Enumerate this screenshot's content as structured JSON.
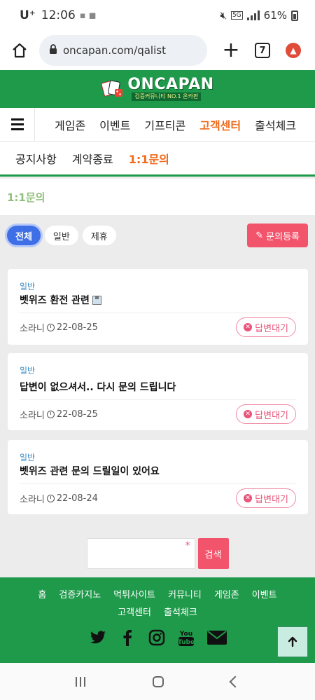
{
  "status_bar": {
    "carrier": "U⁺",
    "time": "12:06",
    "network": "5G",
    "battery": "61%"
  },
  "browser": {
    "url": "oncapan.com/qalist",
    "tab_count": "7"
  },
  "site": {
    "brand": "ONCAPAN",
    "tagline": "검증커뮤니티 NO.1 온카판"
  },
  "main_nav": {
    "items": [
      "게임존",
      "이벤트",
      "기프티콘",
      "고객센터",
      "출석체크"
    ]
  },
  "sub_nav": {
    "items": [
      "공지사항",
      "계약종료",
      "1:1문의"
    ]
  },
  "page": {
    "title": "1:1문의"
  },
  "filters": {
    "items": [
      "전체",
      "일반",
      "제휴"
    ],
    "register_label": "문의등록"
  },
  "posts": [
    {
      "category": "일반",
      "title": "벳위즈 환전 관련",
      "author": "소라니",
      "date": "22-08-25",
      "status": "답변대기"
    },
    {
      "category": "일반",
      "title": "답변이 없으셔서.. 다시 문의 드립니다",
      "author": "소라니",
      "date": "22-08-25",
      "status": "답변대기"
    },
    {
      "category": "일반",
      "title": "벳위즈 관련 문의 드릴일이 있어요",
      "author": "소라니",
      "date": "22-08-24",
      "status": "답변대기"
    }
  ],
  "search": {
    "required_mark": "*",
    "button_label": "검색"
  },
  "footer": {
    "links": [
      "홈",
      "검증카지노",
      "먹튀사이트",
      "커뮤니티",
      "게임존",
      "이벤트",
      "고객센터",
      "출석체크"
    ]
  },
  "colors": {
    "brand_green": "#1f9a4b",
    "active_orange": "#f06a1a",
    "accent_pink": "#f2546b",
    "filter_blue": "#3f6fe6"
  }
}
